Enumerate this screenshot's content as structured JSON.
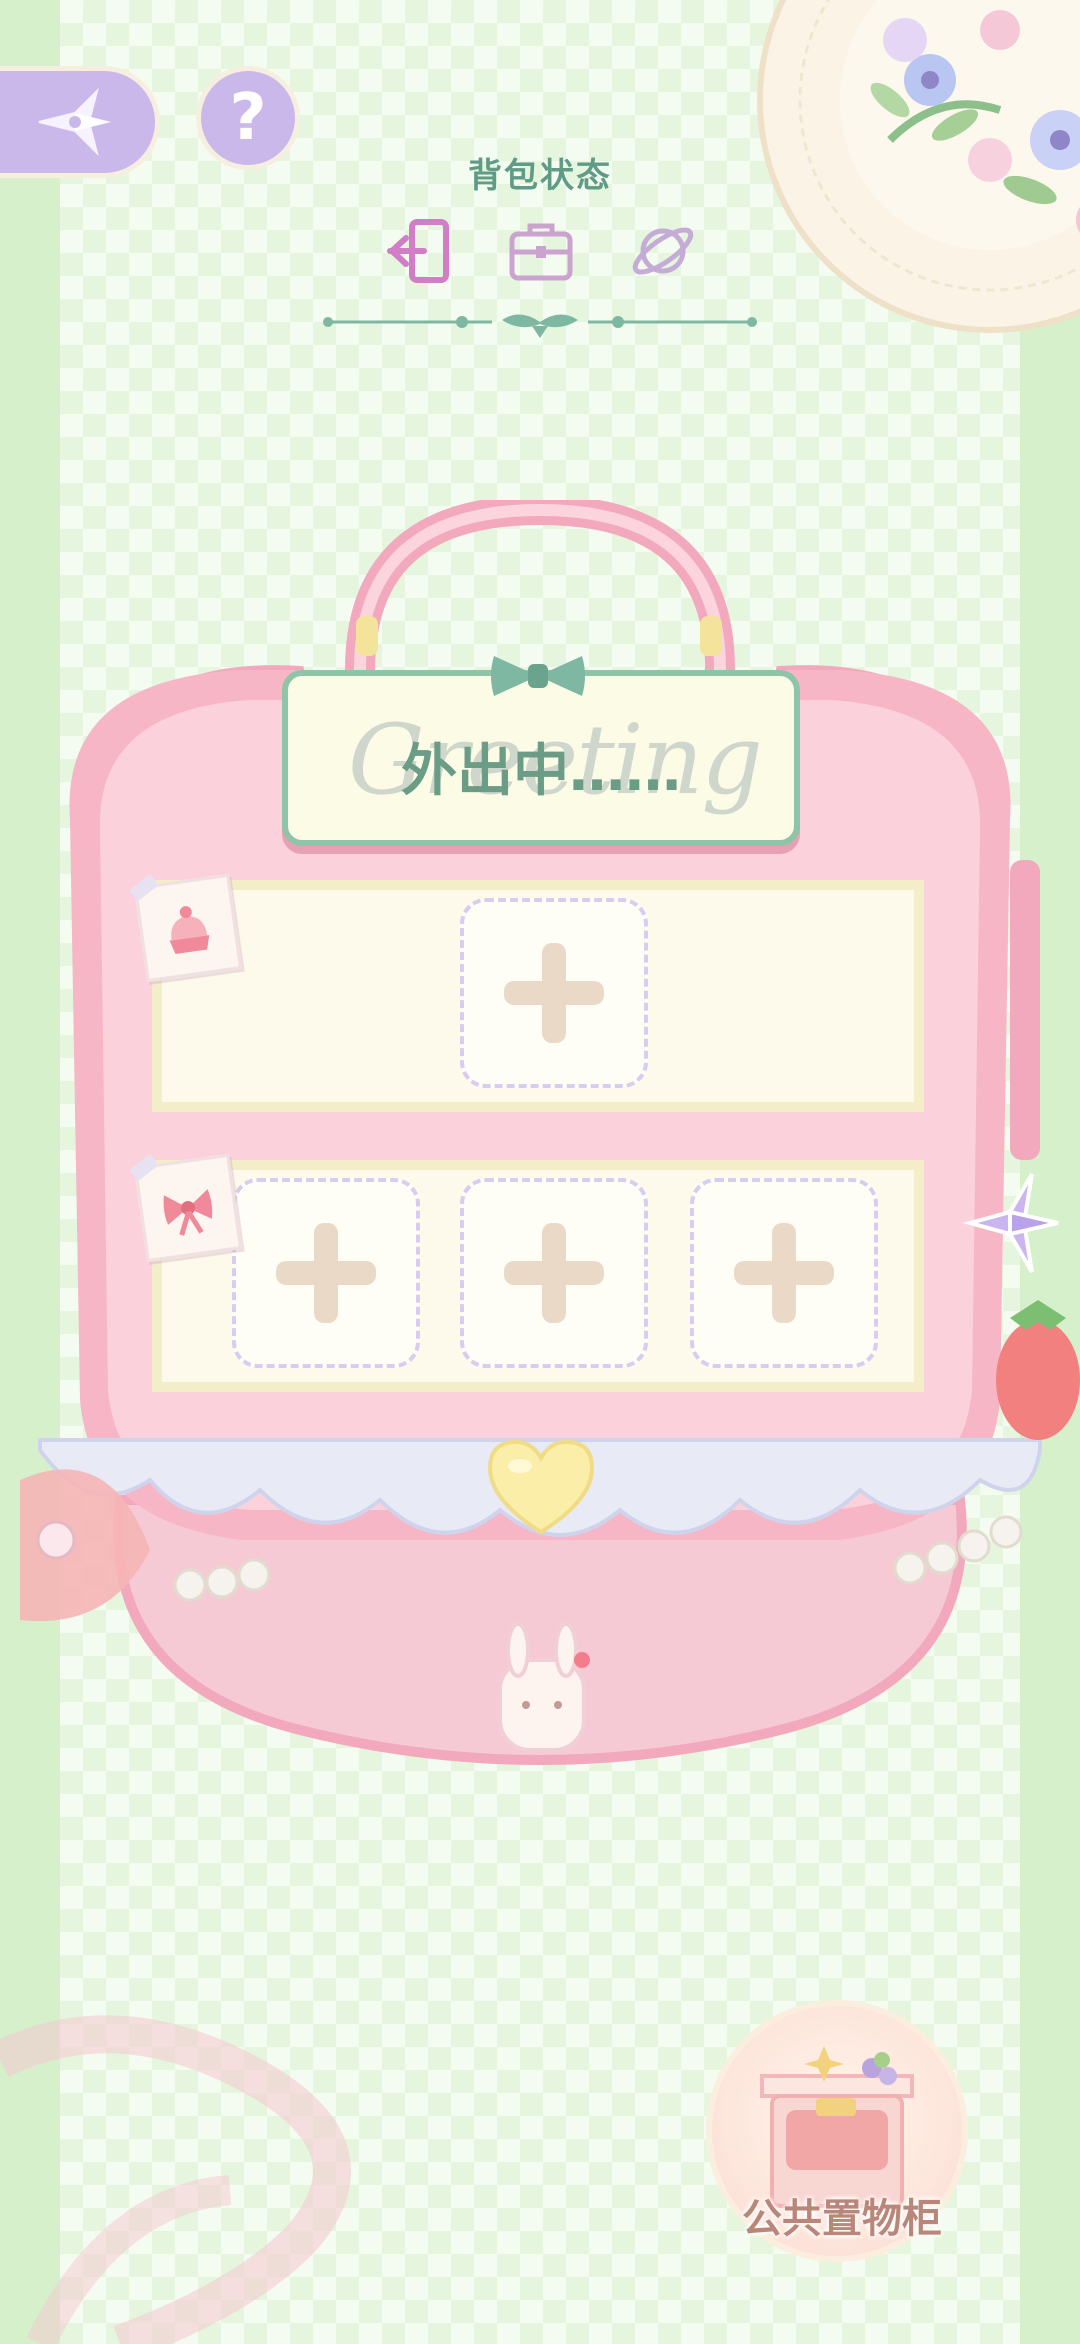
{
  "header": {
    "title": "背包状态",
    "tabs": [
      {
        "icon": "exit-door-icon",
        "active": true
      },
      {
        "icon": "briefcase-icon",
        "active": false
      },
      {
        "icon": "planet-icon",
        "active": false
      }
    ]
  },
  "top_buttons": {
    "back_icon": "compass-star-icon",
    "help_label": "?"
  },
  "backpack": {
    "sign_script": "Greeting",
    "status_text": "外出中……",
    "row1": {
      "sticker_icon": "cake-sticker-icon",
      "slots": 1
    },
    "row2": {
      "sticker_icon": "ribbon-sticker-icon",
      "slots": 3
    }
  },
  "cabinet": {
    "label": "公共置物柜"
  },
  "colors": {
    "accent_green": "#6a9c86",
    "lavender": "#cbb8ea",
    "bag_pink": "#f7b6c6",
    "panel_cream": "#fdfaec"
  }
}
